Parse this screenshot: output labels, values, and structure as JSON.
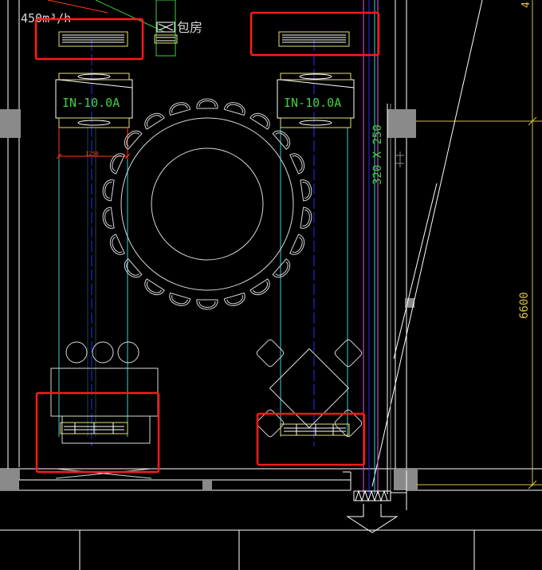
{
  "drawing": {
    "airflow_label": "450m³/h",
    "room_label": "包房",
    "unit_left": "IN-10.0A",
    "unit_right": "IN-10.0A",
    "duct_size": "320 X 250",
    "dimension_width": "1250",
    "dimension_height": "6600",
    "edge_mark": "4"
  },
  "colors": {
    "background": "#000000",
    "wall": "#ffffff",
    "furniture": "#d8d8d8",
    "duct_cyan": "#3fd0d0",
    "center_blue": "#2a2aff",
    "pipe_magenta": "#cc44cc",
    "equip_yellow": "#e8e070",
    "dimension_yellow": "#d8c040",
    "dimension_red": "#ff3a1a",
    "label_green": "#40d040",
    "column_gray": "#8a8a8a",
    "highlight_red": "#ff1a1a"
  }
}
